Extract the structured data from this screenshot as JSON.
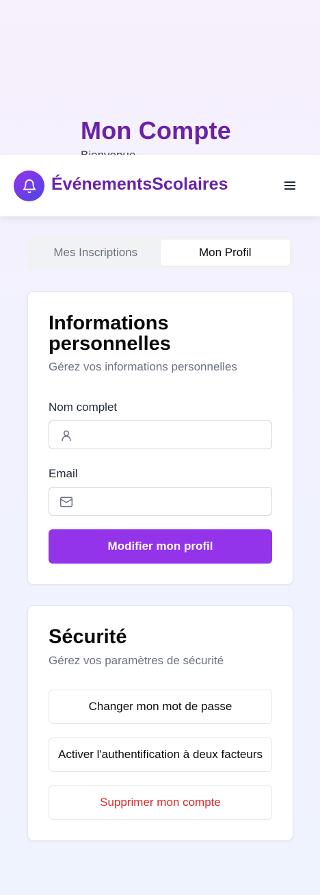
{
  "page": {
    "heading": "Mon Compte",
    "subheading": "Bienvenue"
  },
  "navbar": {
    "brand_name": "ÉvénementsScolaires",
    "logo_icon": "bell-icon",
    "menu_icon": "hamburger-menu-icon"
  },
  "tabs": [
    {
      "label": "Mes Inscriptions",
      "active": false
    },
    {
      "label": "Mon Profil",
      "active": true
    }
  ],
  "profile_card": {
    "title": "Informations personnelles",
    "description": "Gérez vos informations personnelles",
    "fields": {
      "name": {
        "label": "Nom complet",
        "value": "",
        "placeholder": "",
        "icon": "user-icon"
      },
      "email": {
        "label": "Email",
        "value": "",
        "placeholder": "",
        "icon": "mail-icon"
      }
    },
    "submit_label": "Modifier mon profil"
  },
  "security_card": {
    "title": "Sécurité",
    "description": "Gérez vos paramètres de sécurité",
    "buttons": {
      "change_password": "Changer mon mot de passe",
      "two_factor": "Activer l'authentification à deux facteurs",
      "delete_account": "Supprimer mon compte"
    }
  },
  "colors": {
    "brand_purple": "#6b21a8",
    "button_purple": "#9333ea",
    "danger": "#dc2626",
    "logo_gradient_start": "#9333ea",
    "logo_gradient_end": "#4f46e5"
  }
}
